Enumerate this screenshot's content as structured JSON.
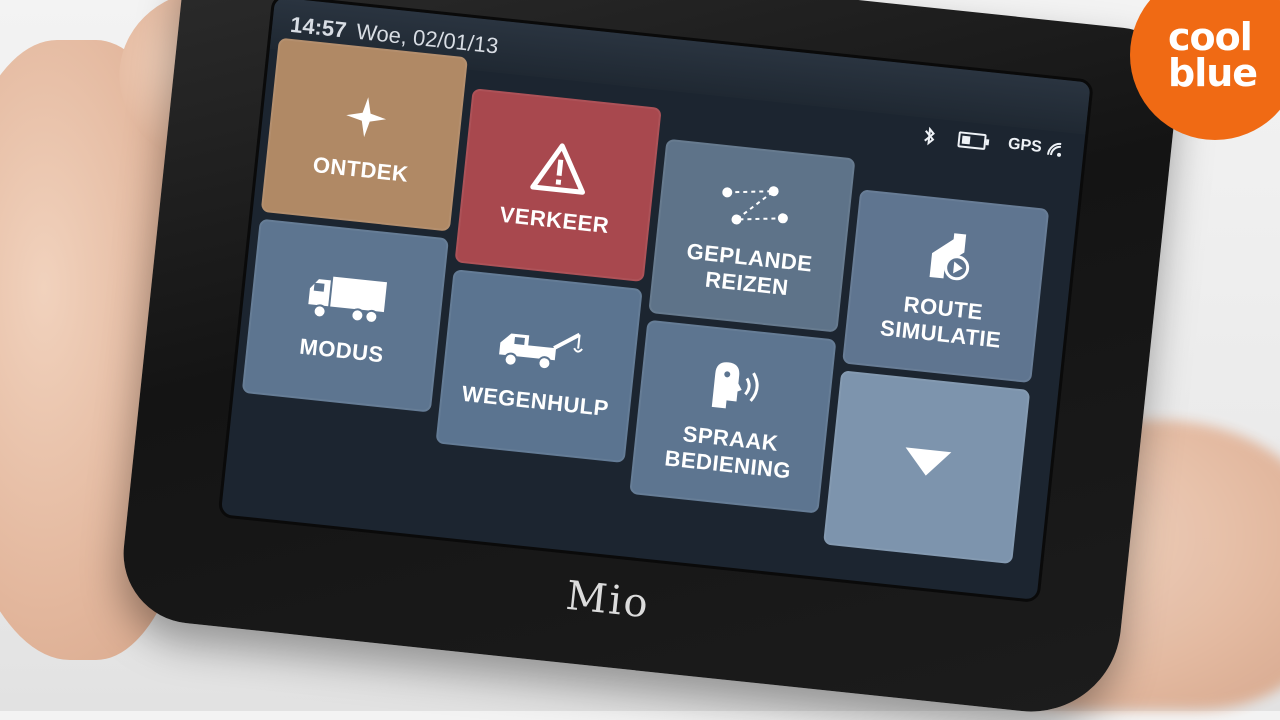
{
  "statusbar": {
    "time": "14:57",
    "date": "Woe, 02/01/13",
    "gps_label": "GPS"
  },
  "tiles": [
    {
      "label_line1": "ONTDEK",
      "label_line2": "",
      "icon": "sparkle-icon"
    },
    {
      "label_line1": "VERKEER",
      "label_line2": "",
      "icon": "warning-triangle-icon"
    },
    {
      "label_line1": "GEPLANDE",
      "label_line2": "REIZEN",
      "icon": "route-dots-icon"
    },
    {
      "label_line1": "ROUTE",
      "label_line2": "SIMULATIE",
      "icon": "route-play-icon"
    },
    {
      "label_line1": "MODUS",
      "label_line2": "",
      "icon": "truck-icon"
    },
    {
      "label_line1": "WEGENHULP",
      "label_line2": "",
      "icon": "tow-truck-icon"
    },
    {
      "label_line1": "SPRAAK",
      "label_line2": "BEDIENING",
      "icon": "voice-icon"
    },
    {
      "label_line1": "",
      "label_line2": "",
      "icon": "arrow-down-icon"
    }
  ],
  "device": {
    "brand": "Mio"
  },
  "badge": {
    "line1": "cool",
    "line2": "blue"
  },
  "colors": {
    "ontdek": "#b08965",
    "verkeer": "#a8484e",
    "blue_tile": "#5d7590",
    "down_tile": "#7d94ad",
    "coolblue": "#f06a14"
  }
}
